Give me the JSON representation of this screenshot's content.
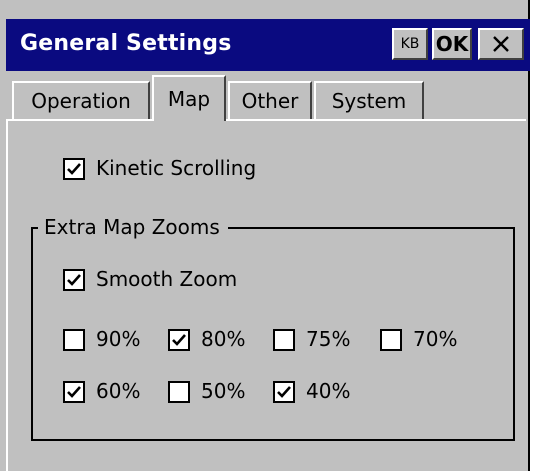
{
  "window": {
    "title": "General Settings",
    "kb_label": "KB",
    "ok_label": "OK",
    "close_icon": "close-icon"
  },
  "tabs": [
    {
      "label": "Operation",
      "active": false
    },
    {
      "label": "Map",
      "active": true
    },
    {
      "label": "Other",
      "active": false
    },
    {
      "label": "System",
      "active": false
    }
  ],
  "kinetic_scrolling": {
    "label": "Kinetic Scrolling",
    "checked": true
  },
  "extra_zooms": {
    "legend": "Extra Map Zooms",
    "smooth_zoom": {
      "label": "Smooth Zoom",
      "checked": true
    },
    "options": [
      {
        "label": "90%",
        "checked": false
      },
      {
        "label": "80%",
        "checked": true
      },
      {
        "label": "75%",
        "checked": false
      },
      {
        "label": "70%",
        "checked": false
      },
      {
        "label": "60%",
        "checked": true
      },
      {
        "label": "50%",
        "checked": false
      },
      {
        "label": "40%",
        "checked": true
      }
    ]
  },
  "colors": {
    "titlebar": "#0a0a80",
    "face": "#c0c0c0",
    "title_text": "#ffffff"
  }
}
